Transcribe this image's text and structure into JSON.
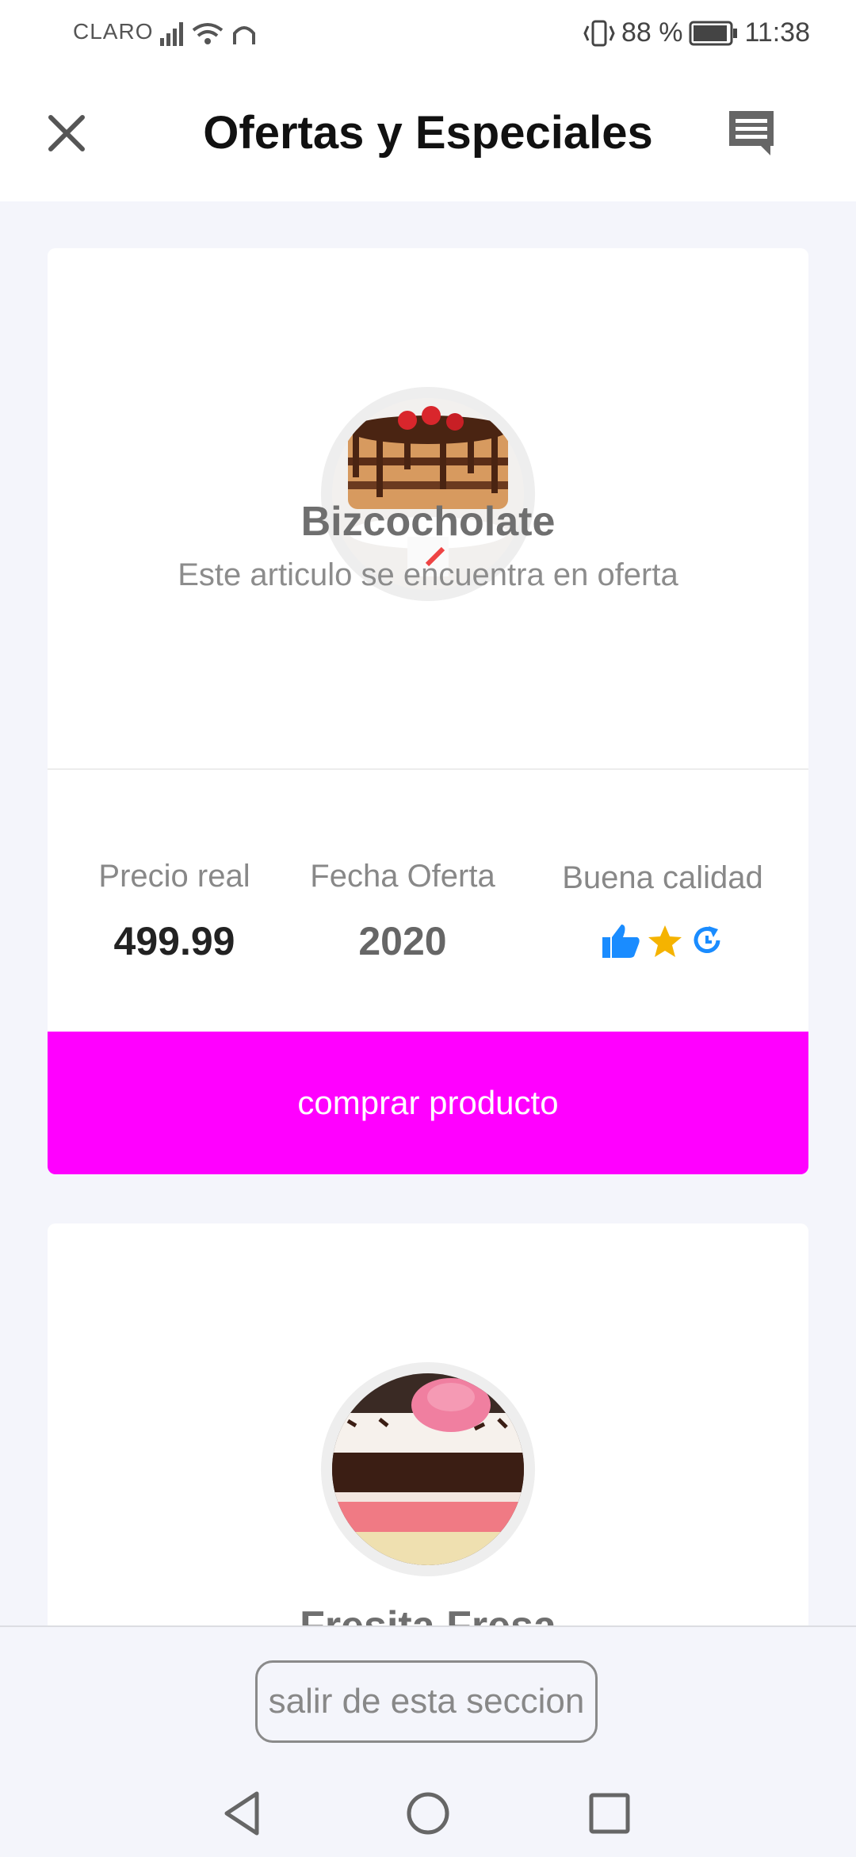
{
  "status_bar": {
    "carrier": "CLARO",
    "battery": "88 %",
    "time": "11:38"
  },
  "header": {
    "title": "Ofertas y Especiales",
    "close_icon": "close-icon",
    "chat_icon": "chat-icon"
  },
  "offers": [
    {
      "name": "Bizcocholate",
      "description": "Este articulo se encuentra en oferta",
      "stats": [
        {
          "label": "Precio real",
          "value": "499.99"
        },
        {
          "label": "Fecha Oferta",
          "value": "2020"
        },
        {
          "label": "Buena calidad",
          "icons": [
            "thumbs-up-icon",
            "star-icon",
            "refresh-icon"
          ]
        }
      ],
      "button_label": "comprar producto"
    },
    {
      "name": "Fresita Fresa"
    }
  ],
  "footer": {
    "exit_label": "salir de esta seccion"
  },
  "colors": {
    "buy_button": "#ff00ff",
    "quality_icon_blue": "#1a8cff",
    "quality_star": "#f5b300"
  }
}
